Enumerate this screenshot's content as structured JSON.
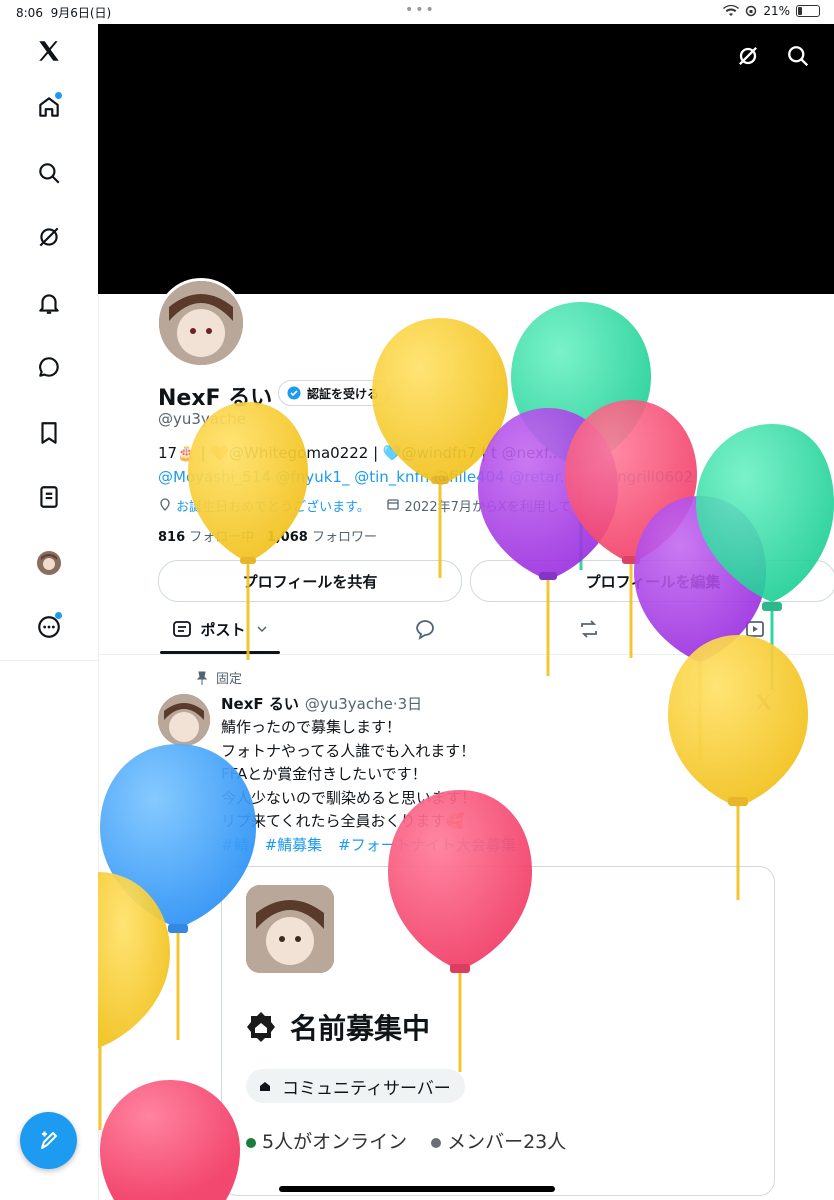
{
  "status_bar": {
    "time": "8:06",
    "date": "9月6日(日)",
    "dots": "•••",
    "battery": "21%",
    "battery_level": 0.21
  },
  "sidebar": {
    "items": [
      {
        "icon": "x-logo-icon"
      },
      {
        "icon": "home-icon"
      },
      {
        "icon": "search-icon"
      },
      {
        "icon": "grok-icon"
      },
      {
        "icon": "notifications-icon"
      },
      {
        "icon": "messages-icon"
      },
      {
        "icon": "bookmarks-icon"
      },
      {
        "icon": "lists-icon"
      },
      {
        "icon": "profile-avatar"
      },
      {
        "icon": "more-icon"
      }
    ],
    "compose_icon": "compose-icon"
  },
  "profile": {
    "name": "NexF るい",
    "verify_label": "認証を受ける",
    "handle": "@yu3yache",
    "bio_line1": "17🎂 | 🧡@Whitegoma0222 | 🩵@windfn7 | t @nexf...",
    "bio_line2": "@Moyashi_514 @fnyuk1_ @tin_knfn @fille404 @retar... @mongrill0602",
    "birthday": "お誕生日おめでとうございます。",
    "joined": "2022年7月からXを利用しています",
    "following_count": "816",
    "following_label": "フォロー中",
    "followers_count": "1,068",
    "followers_label": "フォロワー",
    "share_button": "プロフィールを共有",
    "edit_button": "プロフィールを編集"
  },
  "tabs": {
    "posts_label": "ポスト"
  },
  "post": {
    "pinned_label": "固定",
    "author": "NexF るい",
    "handle_time": "@yu3yache·3日",
    "lines": [
      "鯖作ったので募集します！",
      "フォトナやってる人誰でも入れます！",
      "FFAとか賞金付きしたいです！",
      "今人少ないので馴染めると思います！",
      "リプ来てくれたら全員おくります🥰"
    ],
    "tags": [
      "#鯖",
      "#鯖募集",
      "#フォートナイト大会募集"
    ]
  },
  "card": {
    "title": "名前募集中",
    "pill": "コミュニティサーバー",
    "online": "5人がオンライン",
    "members": "メンバー23人",
    "online_color": "#1b7f3b",
    "members_color": "#6b6f75"
  },
  "colors": {
    "accent": "#1d9bf0",
    "banner": "#000000"
  }
}
